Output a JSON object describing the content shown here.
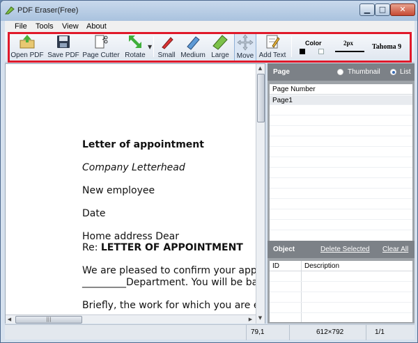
{
  "window": {
    "title": "PDF Eraser(Free)"
  },
  "menu": [
    "File",
    "Tools",
    "View",
    "About"
  ],
  "toolbar": {
    "buttons": [
      {
        "label": "Open PDF",
        "icon": "folder-open-icon"
      },
      {
        "label": "Save PDF",
        "icon": "floppy-disk-icon"
      },
      {
        "label": "Page Cutter",
        "icon": "scissors-page-icon"
      },
      {
        "label": "Rotate",
        "icon": "rotate-arrows-icon"
      },
      {
        "label": "Small",
        "icon": "small-eraser-icon"
      },
      {
        "label": "Medium",
        "icon": "medium-eraser-icon"
      },
      {
        "label": "Large",
        "icon": "large-eraser-icon"
      },
      {
        "label": "Move",
        "icon": "move-cross-icon"
      },
      {
        "label": "Add Text",
        "icon": "add-text-icon"
      }
    ],
    "color_label": "Color",
    "width_label": "2px",
    "font_label": "Tahoma 9",
    "colors": {
      "primary": "#000000",
      "secondary": "#ffffff",
      "highlight": "#e0192a"
    }
  },
  "document": {
    "lines": [
      "Letter of appointment",
      "Company Letterhead",
      "New employee",
      "Date",
      "Home address Dear",
      "Re: ",
      "LETTER OF APPOINTMENT",
      "We are pleased to confirm your appoi",
      "_________Department. You will be bas",
      "Briefly, the work for which you are emp"
    ]
  },
  "page_panel": {
    "title": "Page",
    "view_options": [
      "Thumbnail",
      "List"
    ],
    "selected_view": "List",
    "column": "Page Number",
    "pages": [
      "Page1"
    ]
  },
  "object_panel": {
    "title": "Object",
    "delete_selected": "Delete Selected",
    "clear_all": "Clear All",
    "columns": [
      "ID",
      "Description"
    ]
  },
  "status": {
    "coords": "79,1",
    "page_size": "612×792",
    "page_count": "1/1"
  }
}
